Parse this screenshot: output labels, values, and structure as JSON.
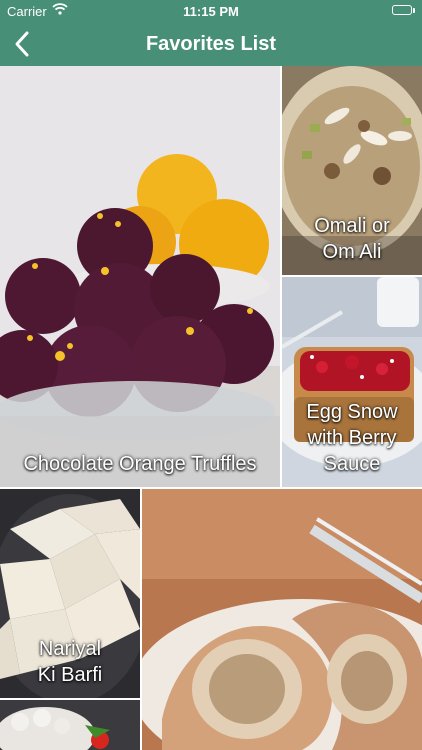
{
  "status_bar": {
    "carrier": "Carrier",
    "time": "11:15 PM"
  },
  "nav": {
    "title": "Favorites List",
    "back_icon": "chevron-left-icon"
  },
  "tiles": [
    {
      "lines": [
        "Chocolate Orange Truffles"
      ]
    },
    {
      "lines": [
        "Omali or",
        "Om Ali"
      ]
    },
    {
      "lines": [
        "Egg Snow",
        "with Berry",
        "Sauce"
      ]
    },
    {
      "lines": [
        "Nariyal",
        "Ki Barfi"
      ]
    }
  ],
  "colors": {
    "accent": "#478f77"
  }
}
